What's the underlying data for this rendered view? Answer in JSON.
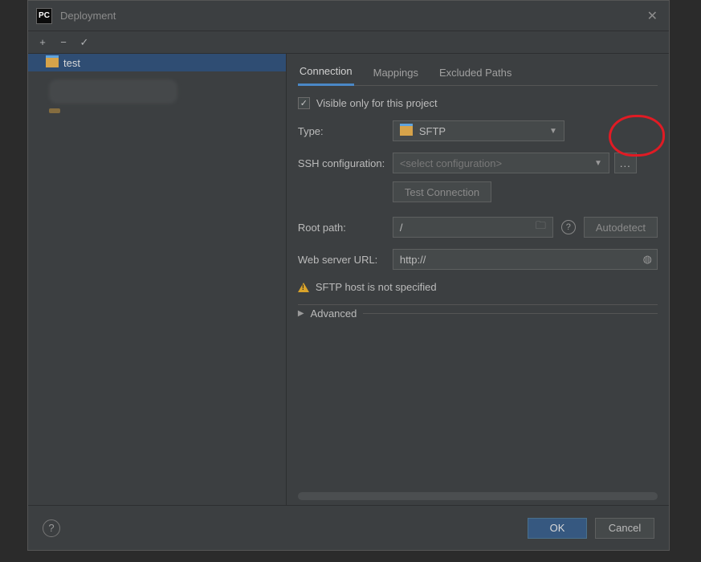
{
  "window": {
    "title": "Deployment",
    "logo": "PC"
  },
  "toolbar": {
    "add": "+",
    "remove": "−",
    "mark": "✓"
  },
  "tree": {
    "items": [
      {
        "label": "test"
      }
    ]
  },
  "tabs": {
    "connection": "Connection",
    "mappings": "Mappings",
    "excluded": "Excluded Paths"
  },
  "form": {
    "visible_only_label": "Visible only for this project",
    "type_label": "Type:",
    "type_value": "SFTP",
    "ssh_label": "SSH configuration:",
    "ssh_placeholder": "<select configuration>",
    "ssh_browse": "...",
    "test_connection": "Test Connection",
    "root_label": "Root path:",
    "root_value": "/",
    "autodetect": "Autodetect",
    "url_label": "Web server URL:",
    "url_value": "http://",
    "warning": "SFTP host is not specified",
    "advanced": "Advanced"
  },
  "footer": {
    "help": "?",
    "ok": "OK",
    "cancel": "Cancel"
  }
}
